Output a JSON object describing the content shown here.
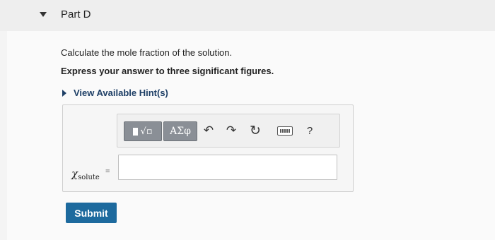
{
  "header": {
    "part_title": "Part D"
  },
  "question": {
    "prompt": "Calculate the mole fraction of the solution.",
    "instruction": "Express your answer to three significant figures.",
    "hint_link": "View Available Hint(s)"
  },
  "toolbar": {
    "templates_symbol": "√▫",
    "greek_label": "ΑΣφ",
    "undo_glyph": "↶",
    "redo_glyph": "↷",
    "reset_glyph": "↻",
    "help_label": "?"
  },
  "answer": {
    "variable": "χ",
    "subscript": "solute",
    "equals": "=",
    "value": ""
  },
  "submit_label": "Submit"
}
